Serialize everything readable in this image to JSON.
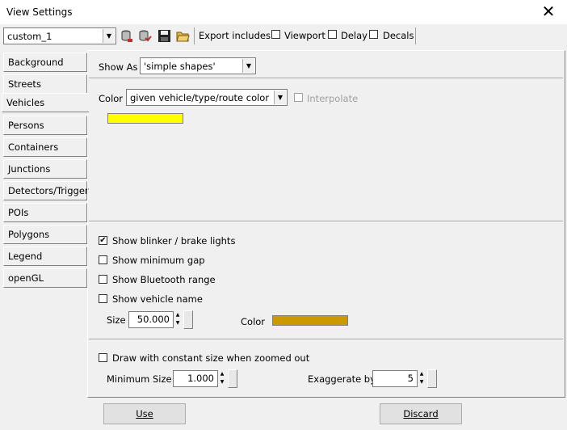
{
  "window": {
    "title": "View Settings",
    "close_glyph": "✕"
  },
  "toolbar": {
    "scheme_value": "custom_1",
    "export_label": "Export includes:",
    "export_options": [
      {
        "label": "Viewport",
        "checked": false
      },
      {
        "label": "Delay",
        "checked": false
      },
      {
        "label": "Decals",
        "checked": false
      }
    ]
  },
  "tabs": [
    {
      "label": "Background"
    },
    {
      "label": "Streets"
    },
    {
      "label": "Vehicles",
      "active": true
    },
    {
      "label": "Persons"
    },
    {
      "label": "Containers"
    },
    {
      "label": "Junctions"
    },
    {
      "label": "Detectors/Trigger"
    },
    {
      "label": "POIs"
    },
    {
      "label": "Polygons"
    },
    {
      "label": "Legend"
    },
    {
      "label": "openGL"
    }
  ],
  "vehicles": {
    "show_as_label": "Show As",
    "show_as_value": "'simple shapes'",
    "color_label": "Color",
    "color_value": "given vehicle/type/route color",
    "interpolate_label": "Interpolate",
    "primary_color": "#ffff00",
    "blinker_label": "Show blinker / brake lights",
    "blinker_checked": "✔",
    "min_gap_label": "Show minimum gap",
    "bluetooth_label": "Show Bluetooth range",
    "name_label": "Show vehicle name",
    "size_label": "Size",
    "size_value": "50.000",
    "name_color_label": "Color",
    "name_color": "#cc9900",
    "constant_size_label": "Draw with constant size when zoomed out",
    "min_size_label": "Minimum Size",
    "min_size_value": "1.000",
    "exaggerate_label": "Exaggerate by",
    "exaggerate_value": "5"
  },
  "buttons": {
    "use_label": "Use",
    "discard_label": "Discard"
  }
}
